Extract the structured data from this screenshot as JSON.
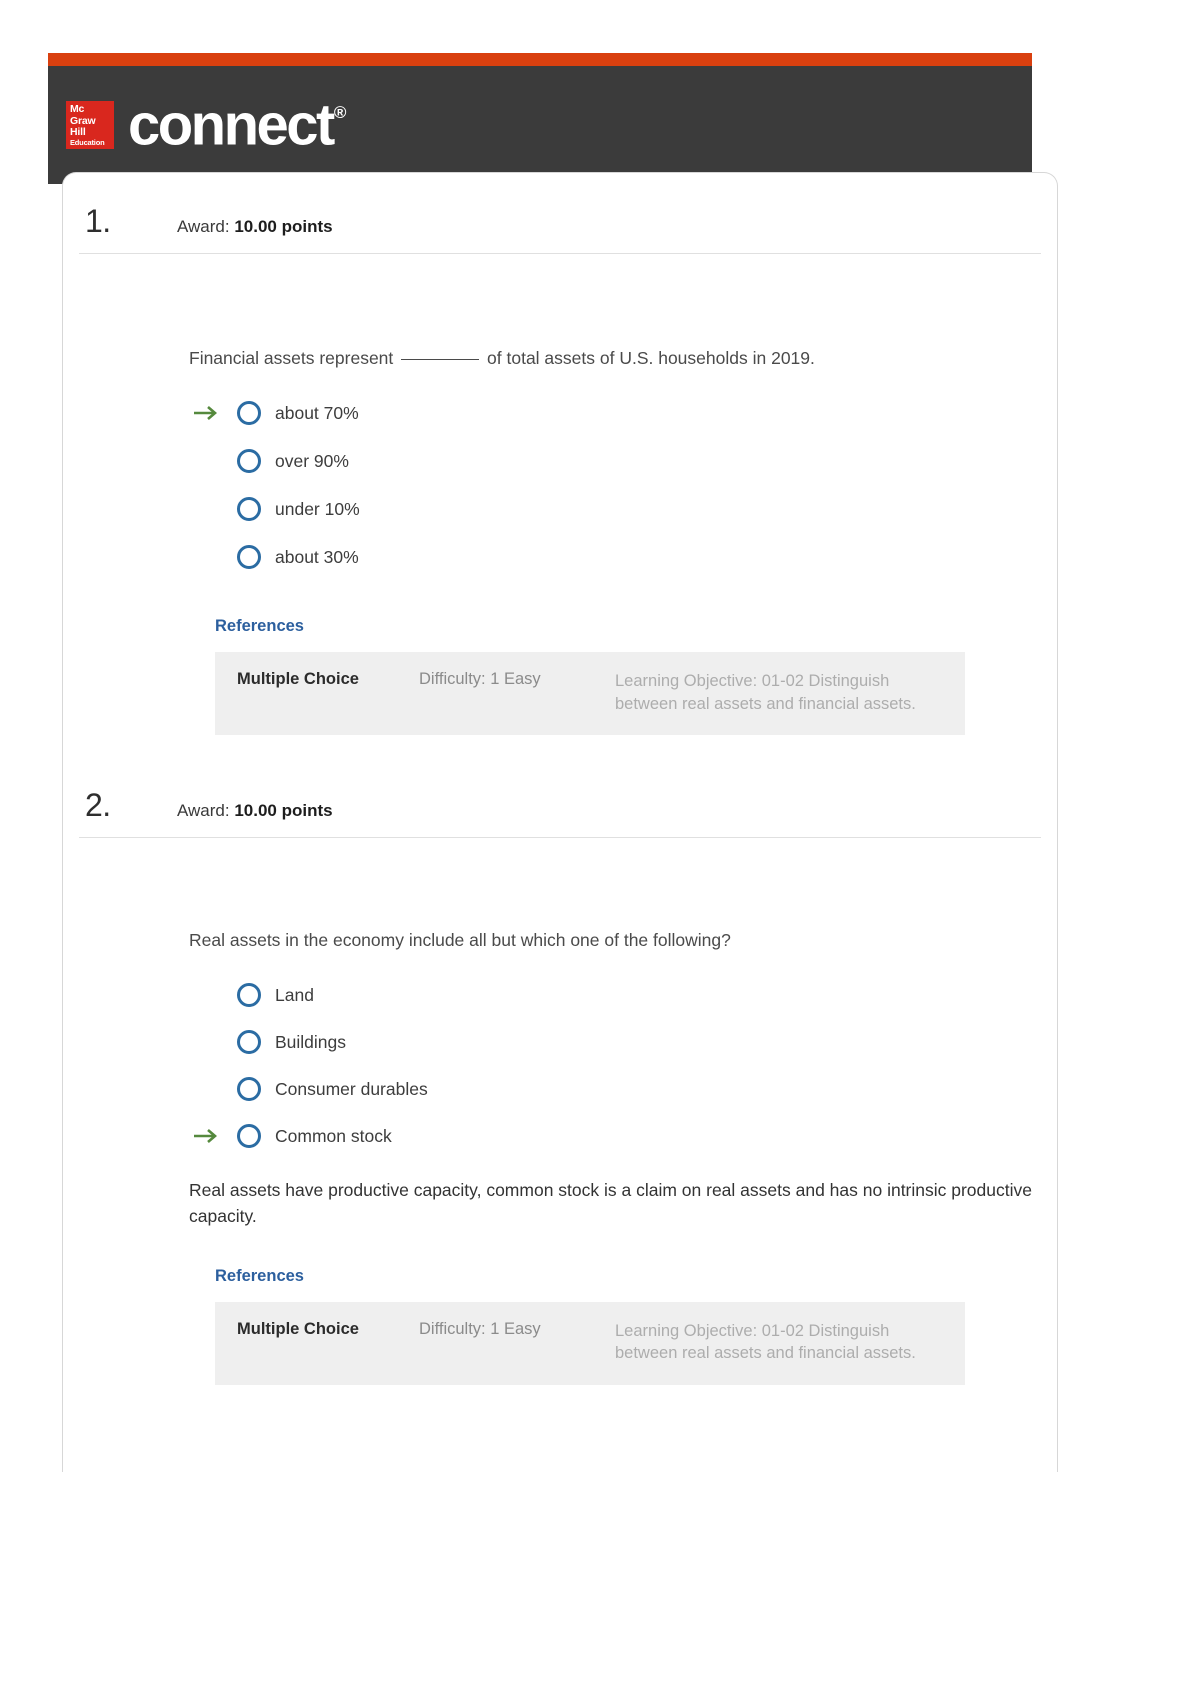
{
  "header": {
    "brand_logo_lines": [
      "Mc",
      "Graw",
      "Hill",
      "Education"
    ],
    "wordmark": "connect",
    "registered_mark": "®",
    "accent_color": "#d9400f",
    "bar_color": "#3b3b3b",
    "logo_color": "#d9271e"
  },
  "questions": [
    {
      "number": "1.",
      "award_label": "Award:",
      "award_points": "10.00 points",
      "text_before_blank": "Financial assets represent",
      "text_after_blank": "of total assets of U.S. households in 2019.",
      "options": [
        {
          "label": "about 70%",
          "correct": true
        },
        {
          "label": "over 90%",
          "correct": false
        },
        {
          "label": "under 10%",
          "correct": false
        },
        {
          "label": "about 30%",
          "correct": false
        }
      ],
      "explanation": "",
      "references_label": "References",
      "meta": {
        "type": "Multiple Choice",
        "difficulty": "Difficulty: 1 Easy",
        "objective": "Learning Objective: 01-02 Distinguish between real assets and financial assets."
      }
    },
    {
      "number": "2.",
      "award_label": "Award:",
      "award_points": "10.00 points",
      "text_before_blank": "Real assets in the economy include all but which one of the following?",
      "text_after_blank": "",
      "options": [
        {
          "label": "Land",
          "correct": false
        },
        {
          "label": "Buildings",
          "correct": false
        },
        {
          "label": "Consumer durables",
          "correct": false
        },
        {
          "label": "Common stock",
          "correct": true
        }
      ],
      "explanation": "Real assets have productive capacity, common stock is a claim on real assets and has no intrinsic productive capacity.",
      "references_label": "References",
      "meta": {
        "type": "Multiple Choice",
        "difficulty": "Difficulty: 1 Easy",
        "objective": "Learning Objective: 01-02 Distinguish between real assets and financial assets."
      }
    }
  ],
  "colors": {
    "radio_ring": "#2b6ca3",
    "correct_arrow": "#55893d",
    "reference_link": "#2c5f9e",
    "meta_background": "#efefef"
  }
}
